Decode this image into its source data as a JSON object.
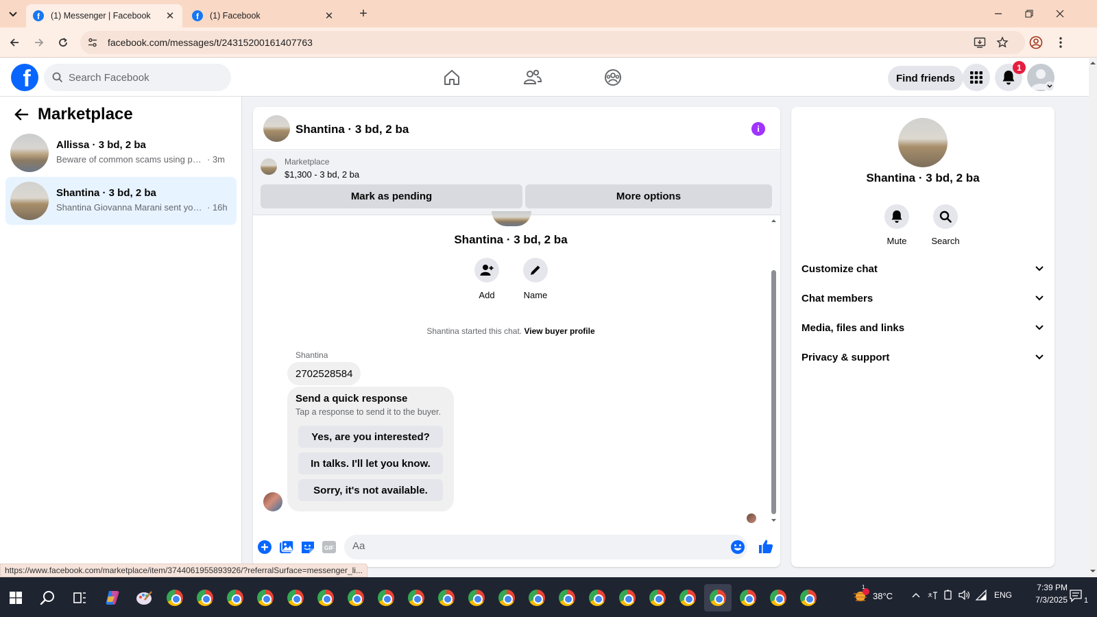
{
  "browser": {
    "tabs": [
      {
        "label": "(1) Messenger | Facebook",
        "active": true
      },
      {
        "label": "(1) Facebook",
        "active": false
      }
    ],
    "url": "facebook.com/messages/t/24315200161407763",
    "status_url": "https://www.facebook.com/marketplace/item/3744061955893926/?referralSurface=messenger_li..."
  },
  "fb": {
    "search_placeholder": "Search Facebook",
    "find_friends": "Find friends",
    "notification_count": "1"
  },
  "sidebar": {
    "title": "Marketplace",
    "conversations": [
      {
        "name": "Allissa · 3 bd, 2 ba",
        "preview": "Beware of common scams using payment apps",
        "time": "· 3m",
        "active": false
      },
      {
        "name": "Shantina · 3 bd, 2 ba",
        "preview": "Shantina Giovanna Marani sent you a message",
        "time": "· 16h",
        "active": true
      }
    ]
  },
  "chat": {
    "title": "Shantina · 3 bd, 2 ba",
    "listing": {
      "label": "Marketplace",
      "title": "$1,300 - 3 bd, 2 ba",
      "mark_pending": "Mark as pending",
      "more_options": "More options"
    },
    "center_name": "Shantina · 3 bd, 2 ba",
    "actions": {
      "add": "Add",
      "name": "Name"
    },
    "started_text": "Shantina started this chat.",
    "view_profile": "View buyer profile",
    "sender": "Shantina",
    "message": "2702528584",
    "quick_response": {
      "title": "Send a quick response",
      "subtitle": "Tap a response to send it to the buyer.",
      "options": [
        "Yes, are you interested?",
        "In talks. I'll let you know.",
        "Sorry, it's not available."
      ]
    },
    "composer_placeholder": "Aa"
  },
  "info_panel": {
    "name": "Shantina · 3 bd, 2 ba",
    "actions": {
      "mute": "Mute",
      "search": "Search"
    },
    "sections": [
      "Customize chat",
      "Chat members",
      "Media, files and links",
      "Privacy & support"
    ]
  },
  "taskbar": {
    "temperature": "38°C",
    "language": "ENG",
    "time": "7:39 PM",
    "date": "7/3/2025",
    "weather_badge": "1",
    "notification_badge": "1"
  },
  "colors": {
    "fb_blue": "#0866ff",
    "active_conv": "#e7f3ff",
    "info_purple": "#a033ff",
    "badge_red": "#e41e3f"
  }
}
